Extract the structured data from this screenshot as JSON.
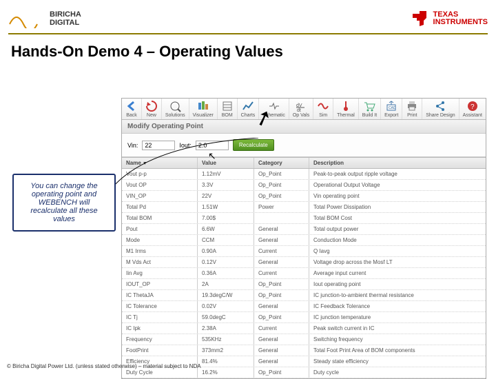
{
  "header": {
    "left_logo_line1": "BIRICHA",
    "left_logo_line2": "DIGITAL",
    "right_logo_line1": "TEXAS",
    "right_logo_line2": "INSTRUMENTS"
  },
  "title": "Hands-On Demo 4 – Operating Values",
  "toolbar": {
    "items": [
      {
        "label": "Back"
      },
      {
        "label": "New"
      },
      {
        "label": "Solutions"
      },
      {
        "label": "Visualizer"
      },
      {
        "label": "BOM"
      },
      {
        "label": "Charts"
      },
      {
        "label": "Schematic"
      },
      {
        "label": "Op Vals"
      },
      {
        "label": "Sim"
      },
      {
        "label": "Thermal"
      },
      {
        "label": "Build It"
      },
      {
        "label": "Export"
      },
      {
        "label": "Print"
      },
      {
        "label": "Share Design"
      },
      {
        "label": "Assistant"
      }
    ]
  },
  "panel": {
    "title": "Modify Operating Point",
    "vin_label": "Vin:",
    "vin_value": "22",
    "iout_label": "Iout:",
    "iout_value": "2.0",
    "recalc": "Recalculate"
  },
  "columns": {
    "name": "Name",
    "value": "Value",
    "category": "Category",
    "description": "Description"
  },
  "rows": [
    {
      "name": "Vout p-p",
      "value": "1.12mV",
      "cat": "Op_Point",
      "desc": "Peak-to-peak output ripple voltage"
    },
    {
      "name": "Vout OP",
      "value": "3.3V",
      "cat": "Op_Point",
      "desc": "Operational Output Voltage"
    },
    {
      "name": "VIN_OP",
      "value": "22V",
      "cat": "Op_Point",
      "desc": "Vin operating point"
    },
    {
      "name": "Total Pd",
      "value": "1.51W",
      "cat": "Power",
      "desc": "Total Power Dissipation"
    },
    {
      "name": "Total BOM",
      "value": "7.00$",
      "cat": "",
      "desc": "Total BOM Cost"
    },
    {
      "name": "Pout",
      "value": "6.6W",
      "cat": "General",
      "desc": "Total output power"
    },
    {
      "name": "Mode",
      "value": "CCM",
      "cat": "General",
      "desc": "Conduction Mode"
    },
    {
      "name": "M1 Irms",
      "value": "0.90A",
      "cat": "Current",
      "desc": "Q Iavg"
    },
    {
      "name": "M Vds Act",
      "value": "0.12V",
      "cat": "General",
      "desc": "Voltage drop across the Mosf LT"
    },
    {
      "name": "Iin Avg",
      "value": "0.36A",
      "cat": "Current",
      "desc": "Average input current"
    },
    {
      "name": "IOUT_OP",
      "value": "2A",
      "cat": "Op_Point",
      "desc": "Iout operating point"
    },
    {
      "name": "IC ThetaJA",
      "value": "19.3degC/W",
      "cat": "Op_Point",
      "desc": "IC junction-to-ambient thermal resistance"
    },
    {
      "name": "IC Tolerance",
      "value": "0.02V",
      "cat": "General",
      "desc": "IC Feedback Tolerance"
    },
    {
      "name": "IC Tj",
      "value": "59.0degC",
      "cat": "Op_Point",
      "desc": "IC junction temperature"
    },
    {
      "name": "IC Ipk",
      "value": "2.38A",
      "cat": "Current",
      "desc": "Peak switch current in IC"
    },
    {
      "name": "Frequency",
      "value": "535KHz",
      "cat": "General",
      "desc": "Switching frequency"
    },
    {
      "name": "FootPrint",
      "value": "373mm2",
      "cat": "General",
      "desc": "Total Foot Print Area of BOM components"
    },
    {
      "name": "Efficiency",
      "value": "81.4%",
      "cat": "General",
      "desc": "Steady state efficiency"
    },
    {
      "name": "Duty Cycle",
      "value": "16.2%",
      "cat": "Op_Point",
      "desc": "Duty cycle"
    }
  ],
  "callout": "You can change the operating point and WEBENCH will recalculate all these values",
  "footer": "© Biricha Digital Power Ltd. (unless stated otherwise) – material subject to NDA"
}
